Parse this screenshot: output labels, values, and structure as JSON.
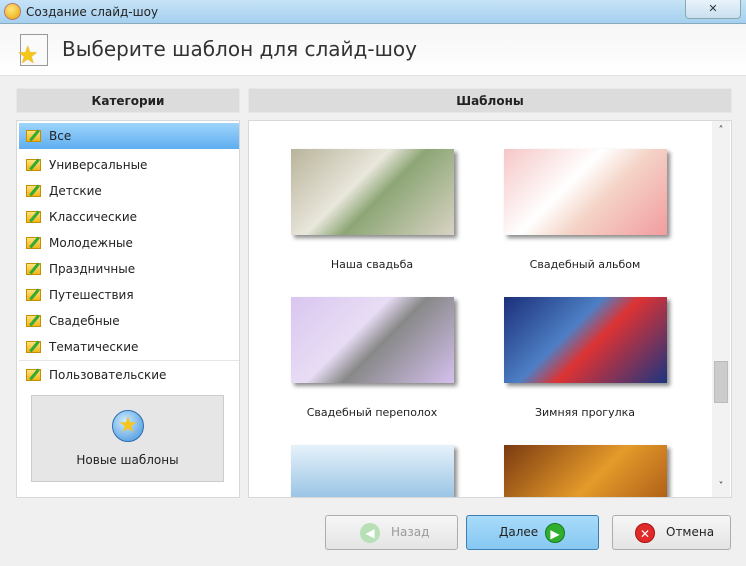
{
  "window": {
    "title": "Создание слайд-шоу",
    "close_label": "✕"
  },
  "header": {
    "title": "Выберите шаблон для слайд-шоу"
  },
  "categories": {
    "header": "Категории",
    "items": [
      "Все",
      "Универсальные",
      "Детские",
      "Классические",
      "Молодежные",
      "Праздничные",
      "Путешествия",
      "Свадебные",
      "Тематические"
    ],
    "user_item": "Пользовательские",
    "selected": "Все",
    "new_templates": "Новые шаблоны"
  },
  "templates": {
    "header": "Шаблоны",
    "items": [
      "Наша свадьба",
      "Свадебный альбом",
      "Свадебный переполох",
      "Зимняя прогулка"
    ]
  },
  "footer": {
    "back": "Назад",
    "next": "Далее",
    "cancel": "Отмена"
  }
}
